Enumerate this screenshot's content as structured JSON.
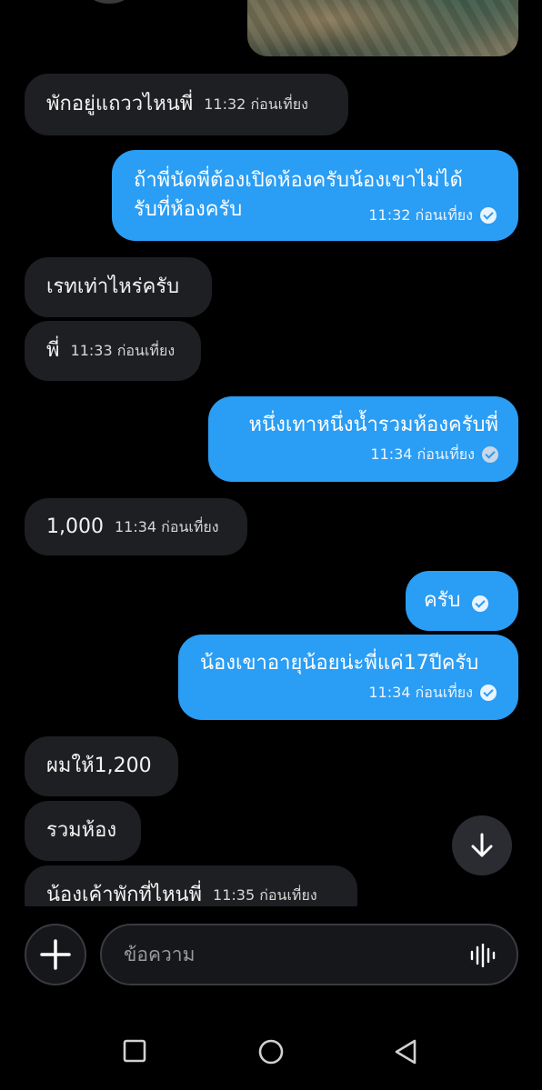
{
  "messages": {
    "m1": {
      "text": "พักอยู่แถววไหนพี่",
      "time": "11:32 ก่อนเที่ยง"
    },
    "m2": {
      "line1": "ถ้าพี่นัดพี่ต้องเปิดห้องครับน้องเขาไม่ได้",
      "line2": "รับที่ห้องครับ",
      "time": "11:32 ก่อนเที่ยง"
    },
    "m3": {
      "text": "เรทเท่าไหร่ครับ"
    },
    "m4": {
      "text": "พี่",
      "time": "11:33 ก่อนเที่ยง"
    },
    "m5": {
      "text": "หนึ่งเทาหนึ่งน้ำรวมห้องครับพี่",
      "time": "11:34 ก่อนเที่ยง"
    },
    "m6": {
      "text": "1,000",
      "time": "11:34 ก่อนเที่ยง"
    },
    "m7": {
      "text": "ครับ"
    },
    "m8": {
      "text": "น้องเขาอายุน้อยน่ะพี่แค่17ปีครับ",
      "time": "11:34 ก่อนเที่ยง"
    },
    "m9": {
      "text": "ผมให้1,200"
    },
    "m10": {
      "text": "รวมห้อง"
    },
    "m11": {
      "text": "น้องเค้าพักที่ไหนพี่",
      "time": "11:35 ก่อนเที่ยง"
    }
  },
  "composer": {
    "placeholder": "ข้อความ"
  },
  "icons": {
    "plus": "plus-icon",
    "mic": "voice-waveform-icon",
    "scroll": "arrow-down-icon",
    "check": "check-circle-icon"
  },
  "colors": {
    "outgoing": "#2a9df4",
    "incoming": "#1e1f22",
    "background": "#000000"
  }
}
